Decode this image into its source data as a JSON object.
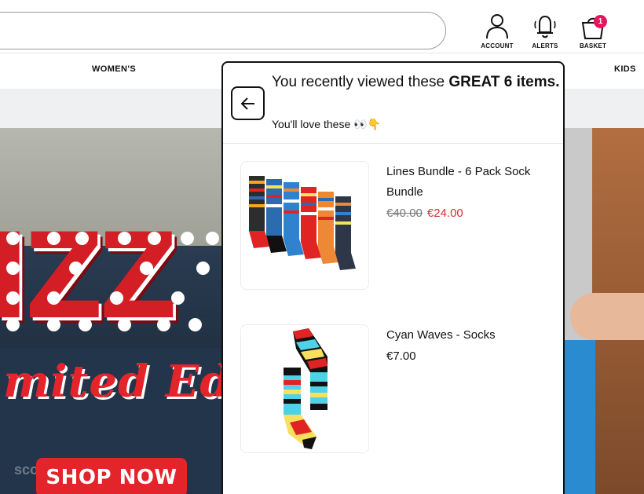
{
  "header": {
    "account_label": "ACCOUNT",
    "alerts_label": "ALERTS",
    "basket_label": "BASKET",
    "basket_count": "1"
  },
  "nav": {
    "women": "WOMEN'S",
    "kids": "KIDS"
  },
  "hero": {
    "letters": "IZZ",
    "script": "mited Editi",
    "button": "SHOP NOW",
    "watermark": "scoprofy"
  },
  "panel": {
    "title_prefix": "You recently viewed these",
    "title_bold": "GREAT 6",
    "title_suffix": "items.",
    "subtitle": "You'll love these 👀👇",
    "items": [
      {
        "name": "Lines Bundle - 6 Pack Sock Bundle",
        "price_old": "€40.00",
        "price": "€24.00"
      },
      {
        "name": "Cyan Waves - Socks",
        "price": "€7.00"
      }
    ]
  },
  "icons": {
    "back": "arrow-left-icon",
    "account": "user-icon",
    "alerts": "bell-icon",
    "basket": "basket-icon"
  },
  "colors": {
    "accent": "#e3242b",
    "badge": "#e6155c",
    "sale": "#d32f2f"
  }
}
